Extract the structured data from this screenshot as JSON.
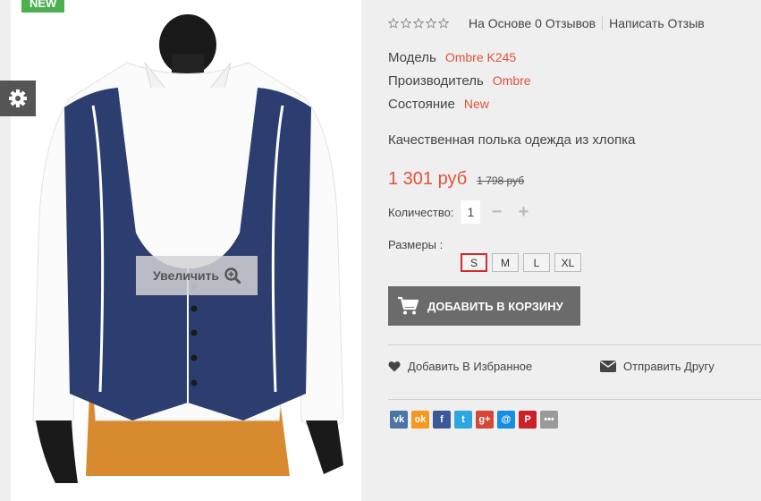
{
  "badge": {
    "new_label": "NEW"
  },
  "icons": {
    "settings": "gear-icon",
    "zoom": "magnifier-plus-icon",
    "cart": "cart-icon",
    "wishlist": "heart-icon",
    "friend": "envelope-icon"
  },
  "image": {
    "zoom_label": "Увеличить"
  },
  "rating": {
    "stars": 0,
    "max": 5,
    "reviews_label": "На Основе 0 Отзывов",
    "write_label": "Написать Отзыв"
  },
  "specs": {
    "model_label": "Модель",
    "model_value": "Ombre K245",
    "maker_label": "Производитель",
    "maker_value": "Ombre",
    "condition_label": "Состояние",
    "condition_value": "New"
  },
  "description": "Качественная полька одежда из хлопка",
  "price": {
    "current": "1 301 руб",
    "old": "1 798 руб"
  },
  "quantity": {
    "label": "Количество:",
    "value": "1",
    "minus": "−",
    "plus": "+"
  },
  "sizes": {
    "label": "Размеры :",
    "options": [
      "S",
      "M",
      "L",
      "XL"
    ],
    "selected": "S"
  },
  "cart": {
    "label": "ДОБАВИТЬ В КОРЗИНУ"
  },
  "actions": {
    "wishlist_label": "Добавить В Избранное",
    "friend_label": "Отправить Другу"
  },
  "share": [
    {
      "name": "vkontakte",
      "glyph": "vk",
      "color": "#4c75a3"
    },
    {
      "name": "odnoklassniki",
      "glyph": "ok",
      "color": "#f59a1f"
    },
    {
      "name": "facebook",
      "glyph": "f",
      "color": "#3b5998"
    },
    {
      "name": "twitter",
      "glyph": "t",
      "color": "#2ea7e0"
    },
    {
      "name": "google-plus",
      "glyph": "g+",
      "color": "#d34836"
    },
    {
      "name": "mail-ru",
      "glyph": "@",
      "color": "#168de2"
    },
    {
      "name": "pinterest",
      "glyph": "P",
      "color": "#cb2027"
    },
    {
      "name": "more",
      "glyph": "•••",
      "color": "#9a9a9a"
    }
  ],
  "colors": {
    "accent": "#e0533a",
    "button": "#6b6b6b",
    "badge": "#4caf50"
  }
}
